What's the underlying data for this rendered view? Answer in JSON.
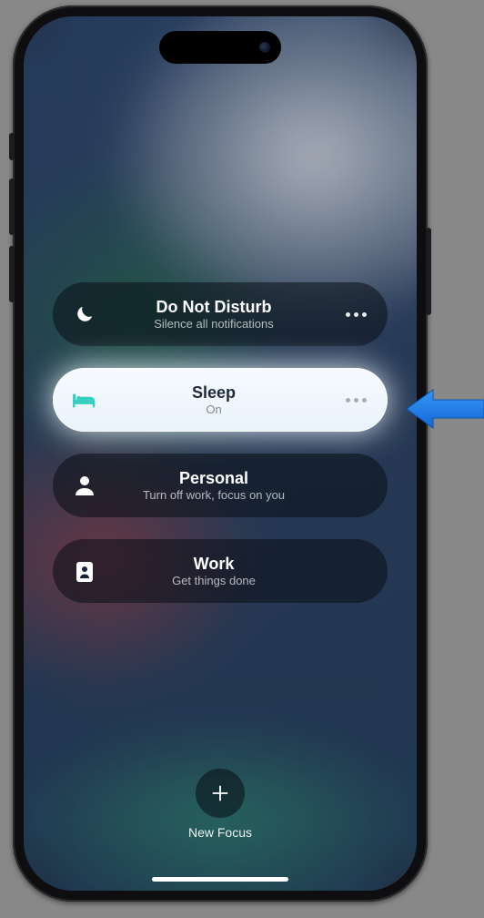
{
  "focus_modes": [
    {
      "id": "dnd",
      "title": "Do Not Disturb",
      "subtitle": "Silence all notifications",
      "active": false,
      "icon": "moon"
    },
    {
      "id": "sleep",
      "title": "Sleep",
      "subtitle": "On",
      "active": true,
      "icon": "bed"
    },
    {
      "id": "personal",
      "title": "Personal",
      "subtitle": "Turn off work, focus on you",
      "active": false,
      "icon": "person"
    },
    {
      "id": "work",
      "title": "Work",
      "subtitle": "Get things done",
      "active": false,
      "icon": "badge"
    }
  ],
  "new_focus_label": "New Focus",
  "colors": {
    "active_icon": "#38cfc3",
    "arrow": "#177ff0"
  }
}
